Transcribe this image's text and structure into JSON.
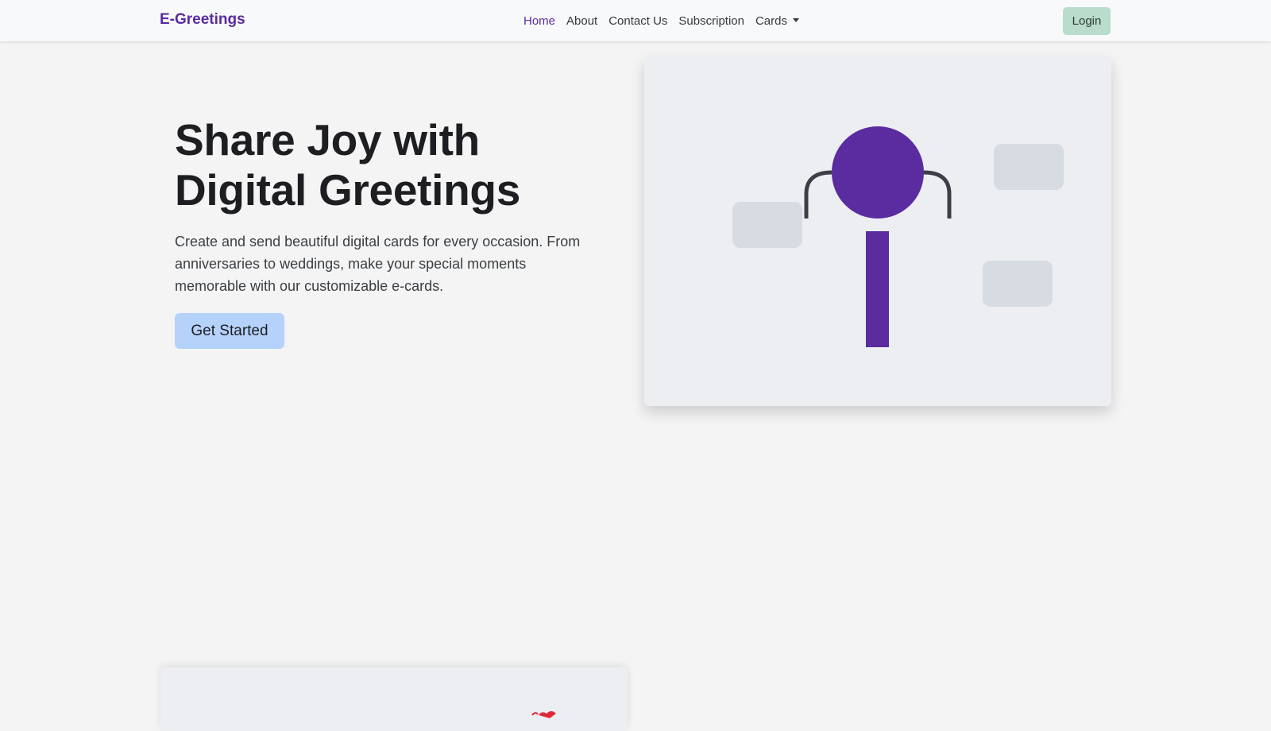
{
  "navbar": {
    "brand": "E-Greetings",
    "links": [
      {
        "label": "Home",
        "active": true
      },
      {
        "label": "About"
      },
      {
        "label": "Contact Us"
      },
      {
        "label": "Subscription"
      },
      {
        "label": "Cards",
        "dropdown": true
      }
    ],
    "login_label": "Login"
  },
  "hero": {
    "title": "Share Joy with Digital Greetings",
    "description": "Create and send beautiful digital cards for every occasion. From anniversaries to weddings, make your special moments memorable with our customizable e-cards.",
    "cta_label": "Get Started"
  },
  "colors": {
    "brand": "#5b2ba0",
    "illustration_accent": "#5b2ba0",
    "login_bg": "#b9dccb",
    "cta_bg": "#b5d2fb",
    "bottom_card_accent": "#e0283a"
  },
  "icons": {
    "illustration": "person-illustration",
    "bottom_card": "heart-icon"
  }
}
